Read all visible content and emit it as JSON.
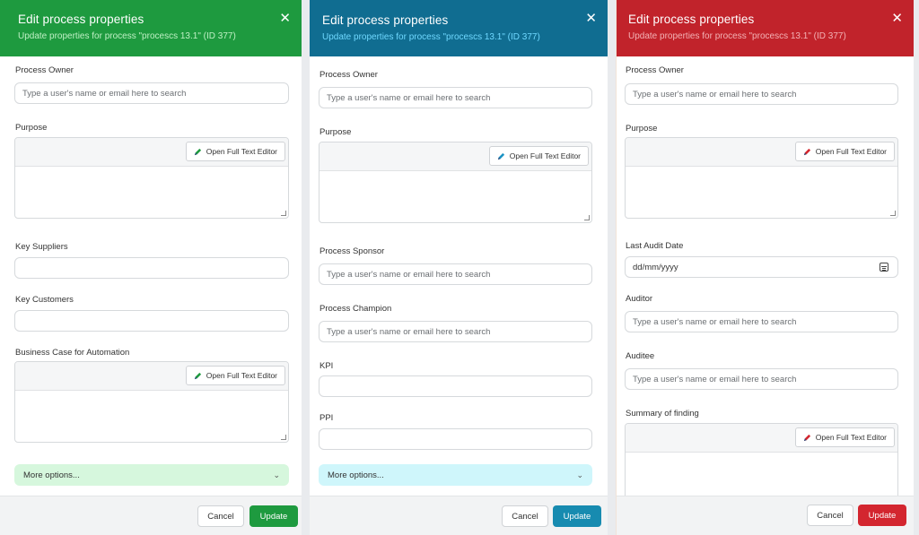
{
  "panels": [
    {
      "title": "Edit process properties",
      "subtitle": "Update properties for process \"procescs 13.1\" (ID 377)",
      "fields": {
        "process_owner_label": "Process Owner",
        "process_owner_placeholder": "Type a user's name or email here to search",
        "purpose_label": "Purpose",
        "full_text_editor_label": "Open Full Text Editor",
        "key_suppliers_label": "Key Suppliers",
        "key_customers_label": "Key Customers",
        "business_case_label": "Business Case for Automation"
      },
      "more_options_label": "More options...",
      "cancel_label": "Cancel",
      "update_label": "Update"
    },
    {
      "title": "Edit process properties",
      "subtitle": "Update properties for process \"procescs 13.1\" (ID 377)",
      "fields": {
        "process_owner_label": "Process Owner",
        "process_owner_placeholder": "Type a user's name or email here to search",
        "purpose_label": "Purpose",
        "full_text_editor_label": "Open Full Text Editor",
        "process_sponsor_label": "Process Sponsor",
        "process_sponsor_placeholder": "Type a user's name or email here to search",
        "process_champion_label": "Process Champion",
        "process_champion_placeholder": "Type a user's name or email here to search",
        "kpi_label": "KPI",
        "ppi_label": "PPI"
      },
      "more_options_label": "More options...",
      "cancel_label": "Cancel",
      "update_label": "Update"
    },
    {
      "title": "Edit process properties",
      "subtitle": "Update properties for process \"procescs 13.1\" (ID 377)",
      "fields": {
        "process_owner_label": "Process Owner",
        "process_owner_placeholder": "Type a user's name or email here to search",
        "purpose_label": "Purpose",
        "full_text_editor_label": "Open Full Text Editor",
        "last_audit_date_label": "Last Audit Date",
        "last_audit_date_placeholder": "dd/mm/yyyy",
        "auditor_label": "Auditor",
        "auditor_placeholder": "Type a user's name or email here to search",
        "auditee_label": "Auditee",
        "auditee_placeholder": "Type a user's name or email here to search",
        "summary_label": "Summary of finding"
      },
      "cancel_label": "Cancel",
      "update_label": "Update"
    }
  ],
  "colors": {
    "green": "#1e9a3f",
    "blue": "#106d91",
    "red": "#c1232b"
  }
}
